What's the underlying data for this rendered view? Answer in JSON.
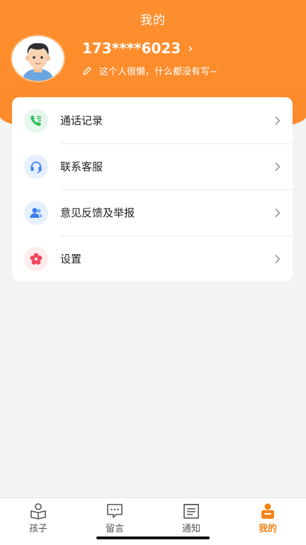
{
  "header": {
    "title": "我的"
  },
  "profile": {
    "phone": "173****6023",
    "chevron": "›",
    "bio": "这个人很懒，什么都没有写~"
  },
  "menu": {
    "items": [
      {
        "label": "通话记录",
        "icon": "phone-log-icon",
        "icon_bg": "#e7f7ec",
        "icon_color": "#2ec05c"
      },
      {
        "label": "联系客服",
        "icon": "headset-icon",
        "icon_bg": "#e6f0fd",
        "icon_color": "#3a7df2"
      },
      {
        "label": "意见反馈及举报",
        "icon": "feedback-icon",
        "icon_bg": "#e6f0fd",
        "icon_color": "#3a7df2"
      },
      {
        "label": "设置",
        "icon": "settings-flower-icon",
        "icon_bg": "#fdebed",
        "icon_color": "#f0475c"
      }
    ]
  },
  "tabbar": {
    "tabs": [
      {
        "label": "孩子",
        "icon": "child-book-icon",
        "active": false
      },
      {
        "label": "留言",
        "icon": "message-icon",
        "active": false
      },
      {
        "label": "通知",
        "icon": "notice-icon",
        "active": false
      },
      {
        "label": "我的",
        "icon": "me-icon",
        "active": true
      }
    ]
  },
  "colors": {
    "accent": "#fb8a2a",
    "tab_active": "#f28418"
  }
}
